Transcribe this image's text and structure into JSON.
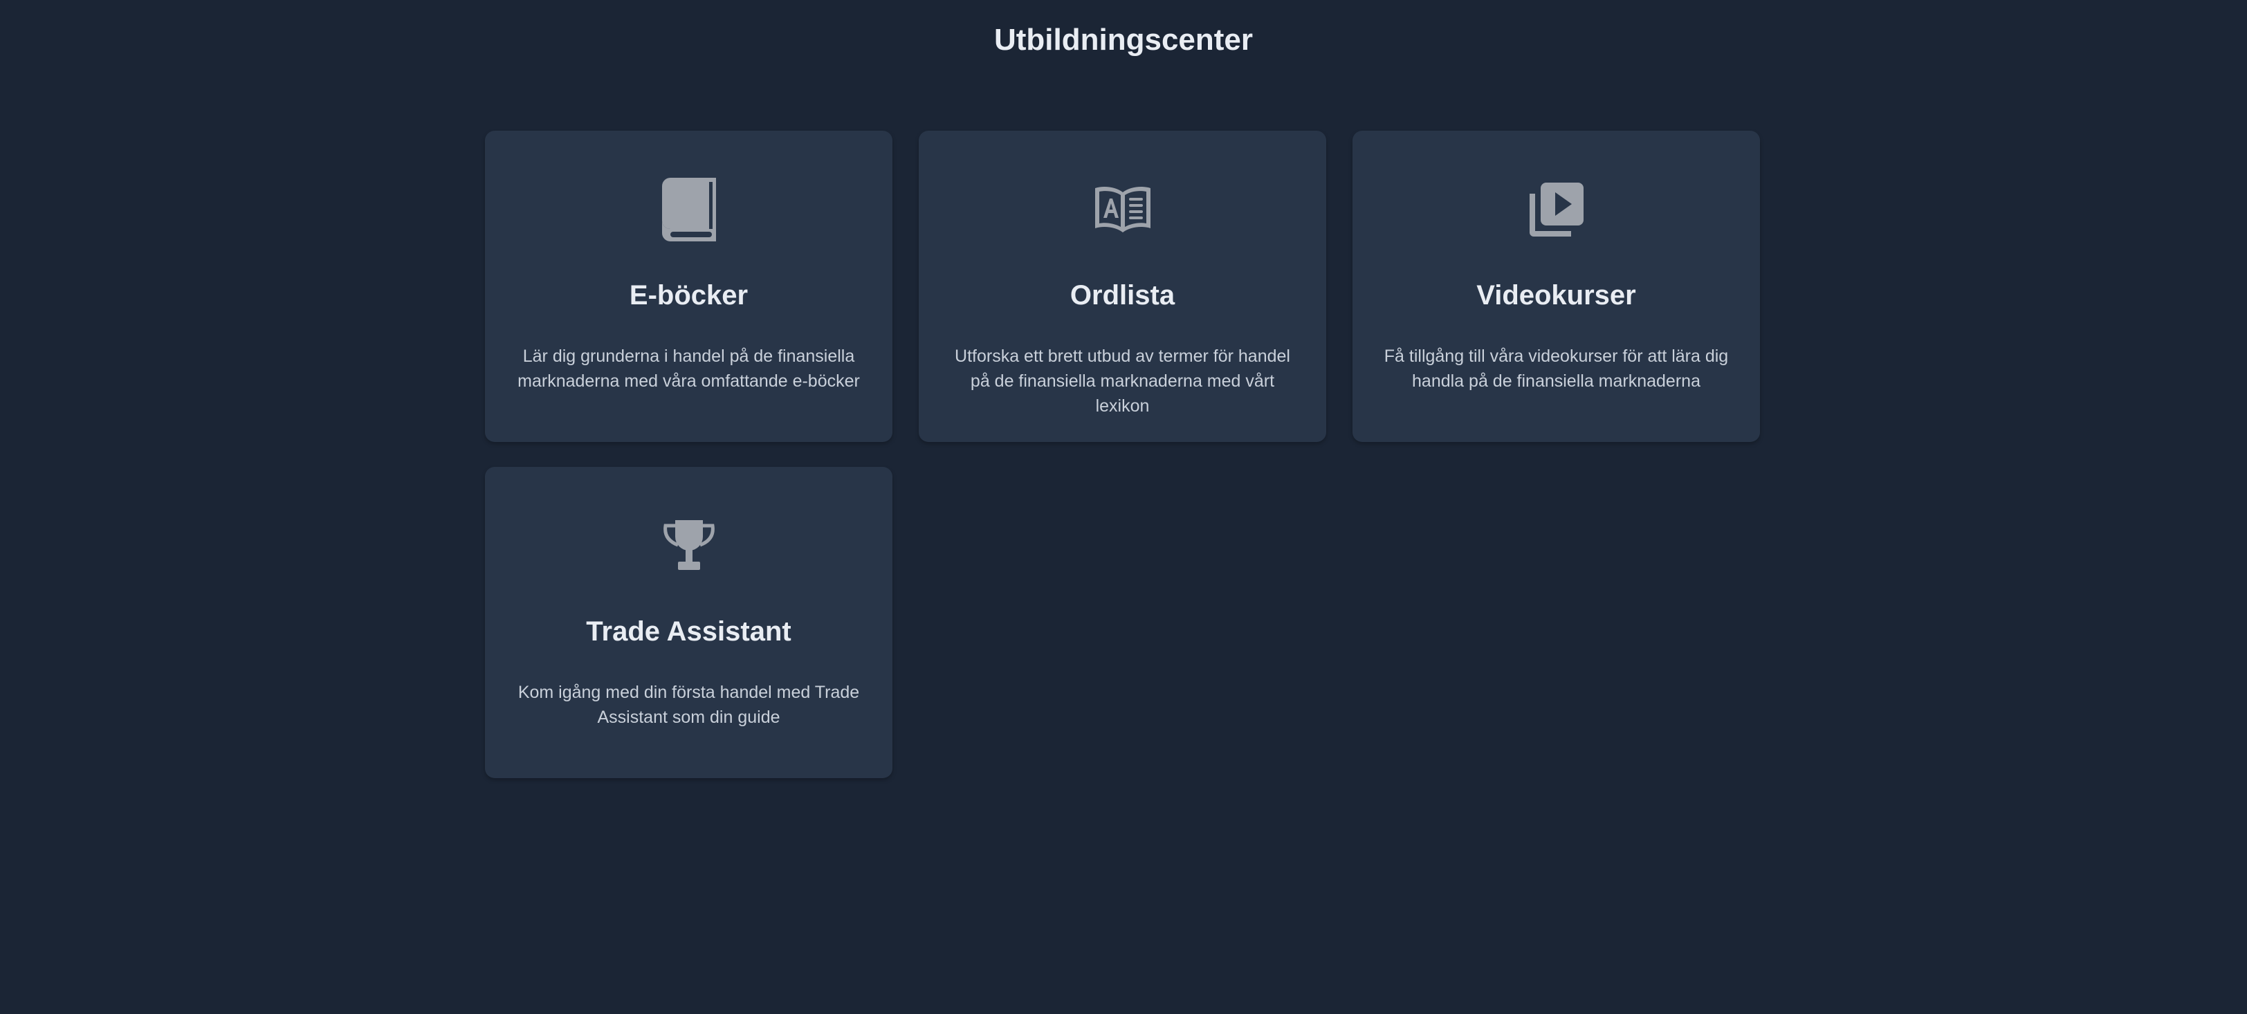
{
  "header": {
    "title": "Utbildningscenter"
  },
  "cards": [
    {
      "icon": "book-icon",
      "title": "E-böcker",
      "description": "Lär dig grunderna i handel på de finansiella marknaderna med våra omfattande e-böcker"
    },
    {
      "icon": "glossary-book-icon",
      "title": "Ordlista",
      "description": "Utforska ett brett utbud av termer för handel på de finansiella marknaderna med vårt lexikon"
    },
    {
      "icon": "video-library-icon",
      "title": "Videokurser",
      "description": "Få tillgång till våra videokurser för att lära dig handla på de finansiella marknaderna"
    },
    {
      "icon": "trophy-icon",
      "title": "Trade Assistant",
      "description": "Kom igång med din första handel med Trade Assistant som din guide"
    }
  ],
  "colors": {
    "background": "#1b2535",
    "card": "#283548",
    "icon": "#9ea3ab",
    "title": "#e9edf3",
    "text": "#c9d0da"
  }
}
